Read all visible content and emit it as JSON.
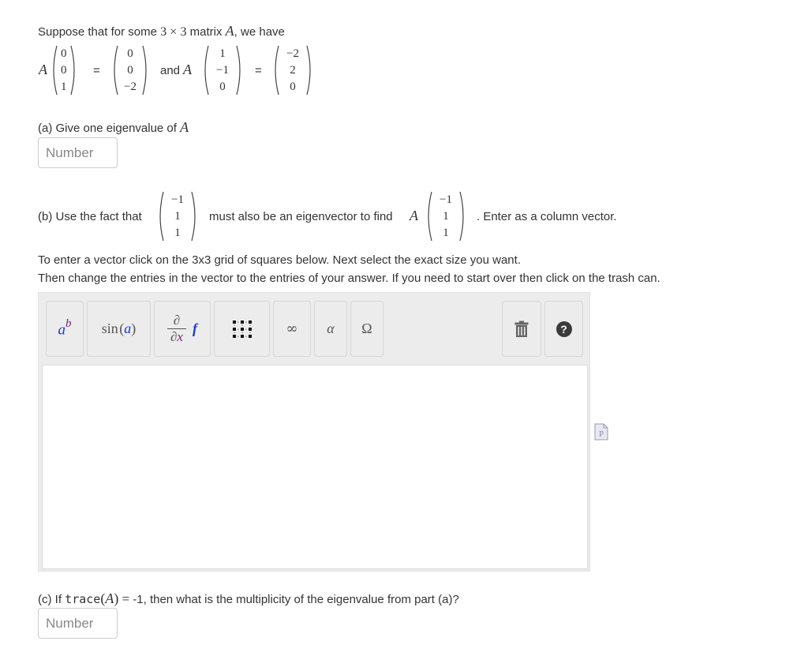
{
  "intro": {
    "text_before": "Suppose that for some",
    "dim_a": "3",
    "times": "×",
    "dim_b": "3",
    "text_matrix": "matrix",
    "matrix_var": "A",
    "text_after": ", we have"
  },
  "equations": {
    "matrix_var": "A",
    "equals": "=",
    "and_text": "and",
    "eq1_input": [
      "0",
      "0",
      "1"
    ],
    "eq1_output": [
      "0",
      "0",
      "−2"
    ],
    "eq2_input": [
      "1",
      "−1",
      "0"
    ],
    "eq2_output": [
      "−2",
      "2",
      "0"
    ]
  },
  "part_a": {
    "label": "(a) Give one eigenvalue of",
    "matrix_var": "A",
    "input_placeholder": "Number",
    "input_value": ""
  },
  "part_b": {
    "text_before": "(b) Use the fact that",
    "vector": [
      "−1",
      "1",
      "1"
    ],
    "text_middle": "must also be an eigenvector to find",
    "matrix_var": "A",
    "vector2": [
      "−1",
      "1",
      "1"
    ],
    "text_after": ". Enter as a column vector."
  },
  "instructions": {
    "line1": "To enter a vector click on the 3x3 grid of squares below. Next select the exact size you want.",
    "line2": "Then change the entries in the vector to the entries of your answer. If you need to start over then click on the trash can."
  },
  "editor": {
    "toolbar": [
      {
        "name": "superscript",
        "icon": "superscript-icon",
        "base": "a",
        "sup": "b"
      },
      {
        "name": "function",
        "icon": "function-icon",
        "fn": "sin",
        "arg": "a"
      },
      {
        "name": "derivative",
        "icon": "derivative-icon",
        "num": "∂",
        "den_d": "∂",
        "den_x": "x",
        "f": "f"
      },
      {
        "name": "matrix",
        "icon": "matrix-grid-icon"
      },
      {
        "name": "infinity",
        "icon": "infinity-icon",
        "glyph": "∞"
      },
      {
        "name": "greek",
        "icon": "alpha-icon",
        "glyph": "α"
      },
      {
        "name": "symbols",
        "icon": "omega-icon",
        "glyph": "Ω"
      },
      {
        "name": "trash",
        "icon": "trash-icon"
      },
      {
        "name": "help",
        "icon": "help-icon",
        "glyph": "?"
      }
    ],
    "content": "",
    "side_icon": "preview-document-icon",
    "side_icon_glyph": "P"
  },
  "part_c": {
    "text_before": "(c) If",
    "trace_fn": "trace",
    "matrix_var": "A",
    "equals": "=",
    "text_after": "-1, then what is the multiplicity of the eigenvalue from part (a)?",
    "input_placeholder": "Number",
    "input_value": ""
  },
  "colors": {
    "text": "#333333",
    "placeholder": "#888888",
    "editor_bg": "#ececec",
    "math_blue": "#1a3bd6",
    "math_purple": "#7a1d7e"
  }
}
